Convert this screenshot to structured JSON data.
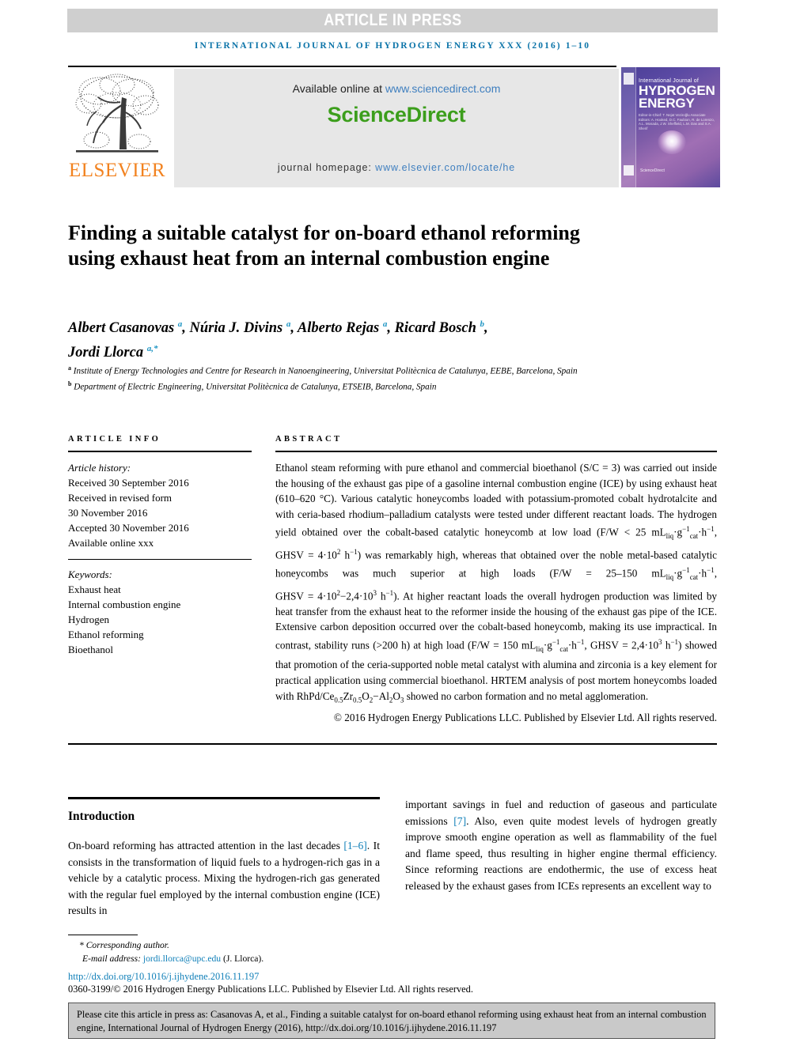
{
  "header": {
    "article_in_press": "ARTICLE IN PRESS",
    "running_head": "INTERNATIONAL JOURNAL OF HYDROGEN ENERGY XXX (2016) 1–10"
  },
  "masthead": {
    "publisher": "ELSEVIER",
    "available_prefix": "Available online at ",
    "available_url": "www.sciencedirect.com",
    "sciencedirect": "ScienceDirect",
    "homepage_prefix": "journal homepage: ",
    "homepage_url": "www.elsevier.com/locate/he",
    "cover": {
      "line1": "International Journal of",
      "line2": "HYDROGEN",
      "line3": "ENERGY",
      "meta": "Editor-in-Chief: T. Nejat Veziroğlu    Associate Editors: A. Hooked, D.C. Faubion, R. de Lorenzo, A.L. Mosada, J.W. Sheffield, L.M. Das and S.A. Sherif",
      "brand": "ScienceDirect"
    }
  },
  "article": {
    "title": "Finding a suitable catalyst for on-board ethanol reforming using exhaust heat from an internal combustion engine",
    "authors_html": "Albert Casanovas <sup>a</sup>, Núria J. Divins <sup>a</sup>, Alberto Rejas <sup>a</sup>, Ricard Bosch <sup>b</sup>, Jordi Llorca <sup>a,*</sup>",
    "affiliation_a": "Institute of Energy Technologies and Centre for Research in Nanoengineering, Universitat Politècnica de Catalunya, EEBE, Barcelona, Spain",
    "affiliation_b": "Department of Electric Engineering, Universitat Politècnica de Catalunya, ETSEIB, Barcelona, Spain"
  },
  "article_info": {
    "heading": "ARTICLE INFO",
    "history_label": "Article history:",
    "history": [
      "Received 30 September 2016",
      "Received in revised form",
      "30 November 2016",
      "Accepted 30 November 2016",
      "Available online xxx"
    ],
    "keywords_label": "Keywords:",
    "keywords": [
      "Exhaust heat",
      "Internal combustion engine",
      "Hydrogen",
      "Ethanol reforming",
      "Bioethanol"
    ]
  },
  "abstract": {
    "heading": "ABSTRACT",
    "copyright": "© 2016 Hydrogen Energy Publications LLC. Published by Elsevier Ltd. All rights reserved."
  },
  "introduction": {
    "heading": "Introduction",
    "left_ref": "[1–6]",
    "right_ref": "[7]"
  },
  "footer": {
    "corresponding": "* Corresponding author.",
    "email_label": "E-mail address: ",
    "email": "jordi.llorca@upc.edu",
    "email_suffix": " (J. Llorca).",
    "doi": "http://dx.doi.org/10.1016/j.ijhydene.2016.11.197",
    "issn": "0360-3199/© 2016 Hydrogen Energy Publications LLC. Published by Elsevier Ltd. All rights reserved.",
    "cite_note": "Please cite this article in press as: Casanovas A, et al., Finding a suitable catalyst for on-board ethanol reforming using exhaust heat from an internal combustion engine, International Journal of Hydrogen Energy (2016), http://dx.doi.org/10.1016/j.ijhydene.2016.11.197"
  },
  "colors": {
    "band_gray": "#cfcfcf",
    "link_blue": "#0f7fb8",
    "elsevier_orange": "#f2821f",
    "sciencedirect_green": "#3c9e1c",
    "runhead_blue": "#0a73a8",
    "cite_box_gray": "#c9c9c9"
  }
}
